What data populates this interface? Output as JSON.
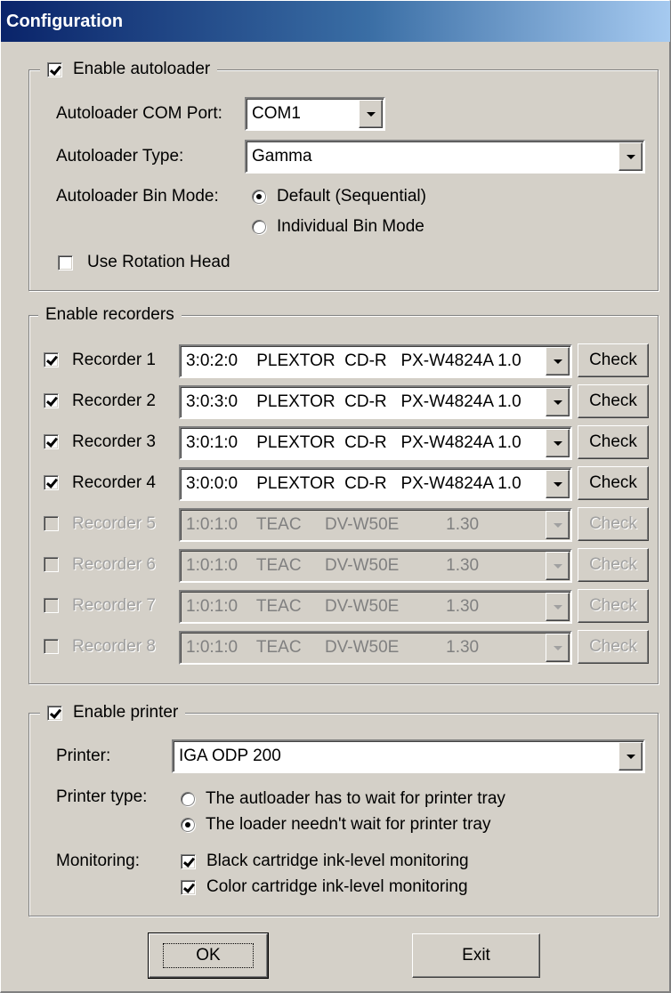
{
  "window": {
    "title": "Configuration"
  },
  "autoloader": {
    "enable_label": "Enable autoloader",
    "enabled": true,
    "com_port_label": "Autoloader COM Port:",
    "com_port_value": "COM1",
    "type_label": "Autoloader Type:",
    "type_value": "Gamma",
    "bin_mode_label": "Autoloader Bin Mode:",
    "bin_mode_options": [
      {
        "label": "Default (Sequential)",
        "selected": true
      },
      {
        "label": "Individual Bin Mode",
        "selected": false
      }
    ],
    "rotation_head_label": "Use Rotation Head",
    "rotation_head_checked": false
  },
  "recorders": {
    "group_label": "Enable recorders",
    "check_label": "Check",
    "items": [
      {
        "label": "Recorder 1",
        "checked": true,
        "enabled": true,
        "device": "3:0:2:0    PLEXTOR  CD-R   PX-W4824A 1.0"
      },
      {
        "label": "Recorder 2",
        "checked": true,
        "enabled": true,
        "device": "3:0:3:0    PLEXTOR  CD-R   PX-W4824A 1.0"
      },
      {
        "label": "Recorder 3",
        "checked": true,
        "enabled": true,
        "device": "3:0:1:0    PLEXTOR  CD-R   PX-W4824A 1.0"
      },
      {
        "label": "Recorder 4",
        "checked": true,
        "enabled": true,
        "device": "3:0:0:0    PLEXTOR  CD-R   PX-W4824A 1.0"
      },
      {
        "label": "Recorder 5",
        "checked": false,
        "enabled": false,
        "device": "1:0:1:0    TEAC     DV-W50E          1.30"
      },
      {
        "label": "Recorder 6",
        "checked": false,
        "enabled": false,
        "device": "1:0:1:0    TEAC     DV-W50E          1.30"
      },
      {
        "label": "Recorder 7",
        "checked": false,
        "enabled": false,
        "device": "1:0:1:0    TEAC     DV-W50E          1.30"
      },
      {
        "label": "Recorder 8",
        "checked": false,
        "enabled": false,
        "device": "1:0:1:0    TEAC     DV-W50E          1.30"
      }
    ]
  },
  "printer": {
    "enable_label": "Enable printer",
    "enabled": true,
    "printer_label": "Printer:",
    "printer_value": "IGA ODP 200",
    "type_label": "Printer type:",
    "type_options": [
      {
        "label": "The autloader has to wait for printer tray",
        "selected": false
      },
      {
        "label": "The loader needn't wait for printer tray",
        "selected": true
      }
    ],
    "monitoring_label": "Monitoring:",
    "monitoring_options": [
      {
        "label": "Black cartridge ink-level monitoring",
        "checked": true
      },
      {
        "label": "Color cartridge ink-level monitoring",
        "checked": true
      }
    ]
  },
  "buttons": {
    "ok": "OK",
    "exit": "Exit"
  },
  "colors": {
    "title_start": "#0a246a",
    "title_end": "#a6caf0",
    "face": "#d4d0c8"
  },
  "icons": [
    "checkbox",
    "radio-button",
    "dropdown-arrow-icon"
  ]
}
